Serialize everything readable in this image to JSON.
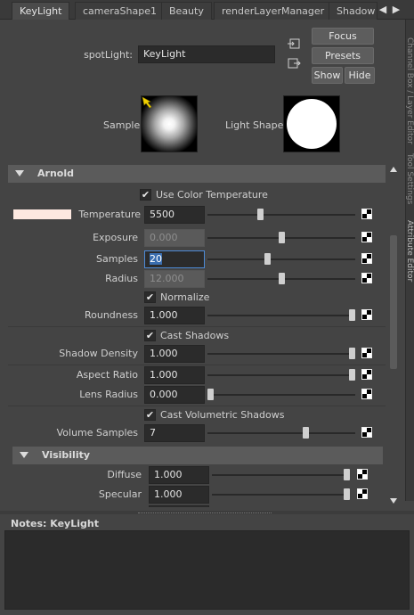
{
  "tabs": [
    {
      "label": "KeyLight",
      "active": true
    },
    {
      "label": "cameraShape1",
      "active": false
    },
    {
      "label": "Beauty",
      "active": false
    },
    {
      "label": "renderLayerManager",
      "active": false
    },
    {
      "label": "Shadow",
      "active": false
    }
  ],
  "tab_nav": {
    "prev": "◀",
    "next": "▶"
  },
  "side_tabs": [
    "Channel Box / Layer Editor",
    "Tool Settings",
    "Attribute Editor"
  ],
  "header": {
    "node_label": "spotLight:",
    "node_name": "KeyLight",
    "focus_label": "Focus",
    "presets_label": "Presets",
    "show_label": "Show",
    "hide_label": "Hide"
  },
  "swatches": {
    "sample_label": "Sample",
    "light_shape_label": "Light Shape"
  },
  "sections": {
    "arnold": "Arnold",
    "visibility": "Visibility"
  },
  "attrs": {
    "use_color_temperature": {
      "label": "Use Color Temperature",
      "checked": true
    },
    "temperature": {
      "label": "Temperature",
      "value": "5500",
      "color": "#fde8e0",
      "slider": 0.35
    },
    "exposure": {
      "label": "Exposure",
      "value": "0.000",
      "dim": true,
      "slider": 0.5
    },
    "samples": {
      "label": "Samples",
      "value": "20",
      "slider": 0.4
    },
    "radius": {
      "label": "Radius",
      "value": "12.000",
      "dim": true,
      "slider": 0.5
    },
    "normalize": {
      "label": "Normalize",
      "checked": true
    },
    "roundness": {
      "label": "Roundness",
      "value": "1.000",
      "slider": 1.0
    },
    "cast_shadows": {
      "label": "Cast Shadows",
      "checked": true
    },
    "shadow_density": {
      "label": "Shadow Density",
      "value": "1.000",
      "slider": 1.0
    },
    "aspect_ratio": {
      "label": "Aspect Ratio",
      "value": "1.000",
      "slider": 1.0
    },
    "lens_radius": {
      "label": "Lens Radius",
      "value": "0.000",
      "slider": 0.0
    },
    "cast_volumetric_shadows": {
      "label": "Cast Volumetric Shadows",
      "checked": true
    },
    "volume_samples": {
      "label": "Volume Samples",
      "value": "7",
      "slider": 0.67
    },
    "diffuse": {
      "label": "Diffuse",
      "value": "1.000",
      "slider": 1.0
    },
    "specular": {
      "label": "Specular",
      "value": "1.000",
      "slider": 1.0
    }
  },
  "notes": {
    "label": "Notes:  KeyLight",
    "text": ""
  },
  "check_glyph": "✔"
}
